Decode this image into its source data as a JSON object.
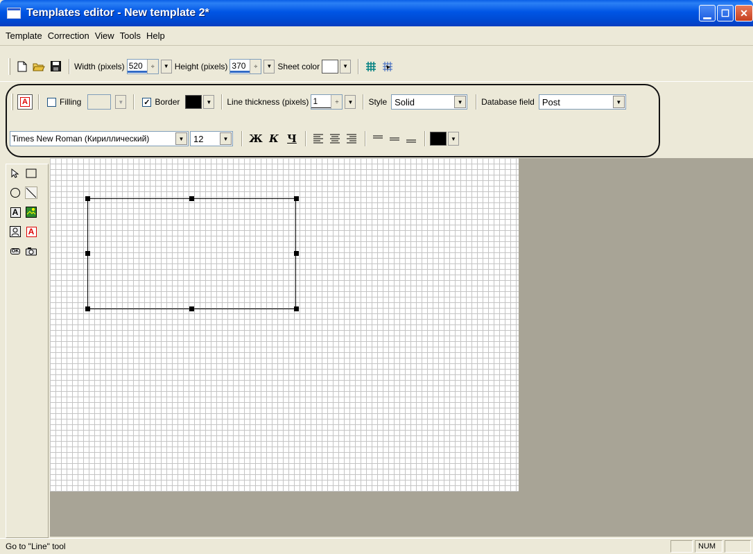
{
  "window": {
    "title": "Templates editor - New template 2*"
  },
  "menu": [
    "Template",
    "Correction",
    "View",
    "Tools",
    "Help"
  ],
  "toolbar1": {
    "width_label": "Width (pixels)",
    "width_value": "520",
    "height_label": "Height (pixels)",
    "height_value": "370",
    "sheet_color_label": "Sheet color",
    "sheet_color": "#ffffff"
  },
  "toolbar2": {
    "filling_label": "Filling",
    "filling_checked": false,
    "border_label": "Border",
    "border_checked": true,
    "border_color": "#000000",
    "thickness_label": "Line thickness (pixels)",
    "thickness_value": "1",
    "style_label": "Style",
    "style_value": "Solid",
    "db_field_label": "Database field",
    "db_field_value": "Post"
  },
  "toolbar3": {
    "font_name": "Times New Roman (Кириллический)",
    "font_size": "12",
    "bold_glyph": "Ж",
    "italic_glyph": "К",
    "underline_glyph": "Ч",
    "text_color": "#000000"
  },
  "status": {
    "text": "Go to \"Line\" tool",
    "num": "NUM"
  }
}
